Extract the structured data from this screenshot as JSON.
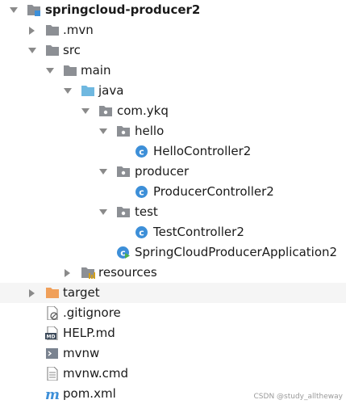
{
  "tree": {
    "root": "springcloud-producer2",
    "mvn": ".mvn",
    "src": "src",
    "main": "main",
    "java": "java",
    "package": "com.ykq",
    "hello": "hello",
    "hello_controller": "HelloController2",
    "producer": "producer",
    "producer_controller": "ProducerController2",
    "test": "test",
    "test_controller": "TestController2",
    "application": "SpringCloudProducerApplication2",
    "resources": "resources",
    "target": "target",
    "gitignore": ".gitignore",
    "help": "HELP.md",
    "mvnw": "mvnw",
    "mvnw_cmd": "mvnw.cmd",
    "pom": "pom.xml"
  },
  "watermark": "CSDN @study_alltheway",
  "colors": {
    "folder": "#8c8f94",
    "source_folder": "#6fb8e0",
    "excluded_folder": "#f0a05a",
    "class_badge": "#3d8fd8",
    "arrow": "#8a8a8a"
  }
}
